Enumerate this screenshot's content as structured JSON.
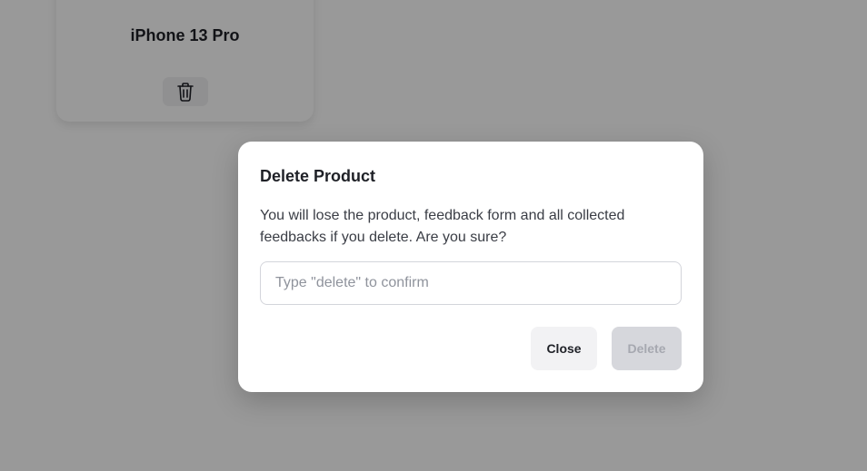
{
  "background_card": {
    "product_name": "iPhone 13 Pro",
    "delete_icon": "trash-icon"
  },
  "modal": {
    "title": "Delete Product",
    "description": "You will lose the product, feedback form and all collected feedbacks if you delete. Are you sure?",
    "confirm_input": {
      "value": "",
      "placeholder": "Type \"delete\" to confirm"
    },
    "close_label": "Close",
    "delete_label": "Delete",
    "delete_enabled": false
  },
  "colors": {
    "overlay": "#000000",
    "modal_background": "#ffffff",
    "close_button_bg": "#f2f2f4",
    "delete_button_disabled_bg": "#d6d7dc",
    "delete_button_disabled_text": "#a6a8b0"
  }
}
